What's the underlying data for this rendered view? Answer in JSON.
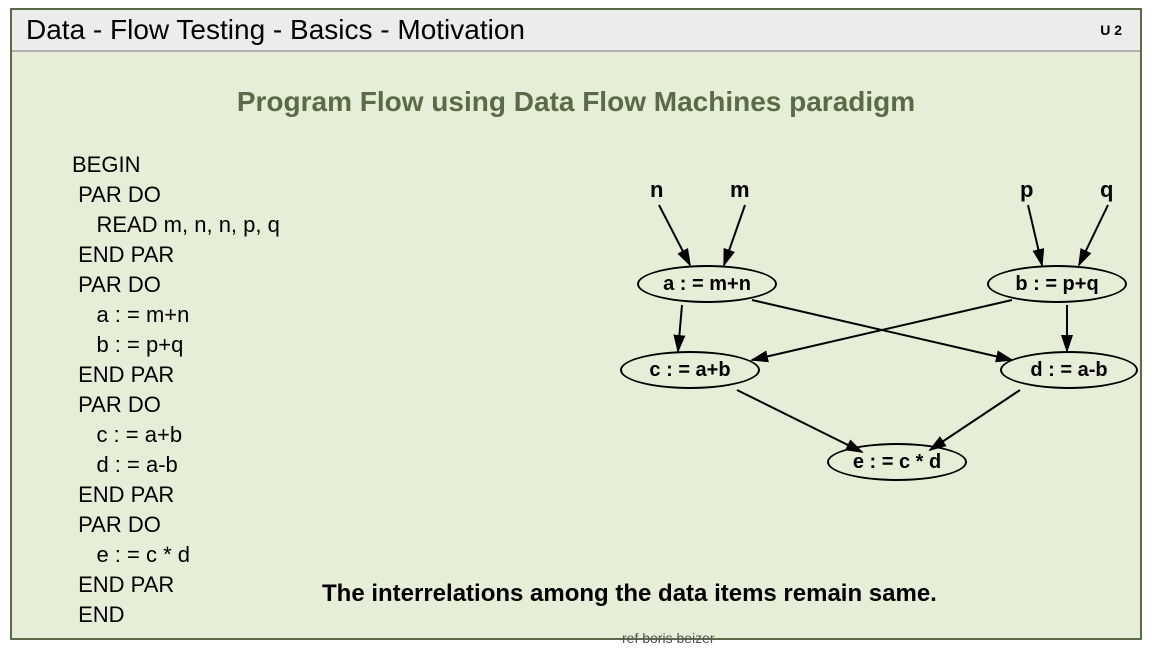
{
  "header": {
    "title": "Data - Flow Testing   -  Basics  - Motivation",
    "unit": "U 2"
  },
  "subtitle": "Program Flow using Data Flow Machines paradigm",
  "code": "BEGIN\n PAR DO\n    READ m, n, n, p, q\n END PAR\n PAR DO\n    a : = m+n\n    b : = p+q\n END PAR\n PAR DO\n    c : = a+b\n    d : = a-b\n END PAR\n PAR DO\n    e : = c * d\n END PAR\n END",
  "diagram": {
    "inputs": {
      "n": "n",
      "m": "m",
      "p": "p",
      "q": "q"
    },
    "nodes": {
      "a": "a : = m+n",
      "b": "b : = p+q",
      "c": "c : = a+b",
      "d": "d : = a-b",
      "e": "e : = c * d"
    }
  },
  "footer": "The interrelations among the data items remain same.",
  "ref": "ref boris beizer"
}
